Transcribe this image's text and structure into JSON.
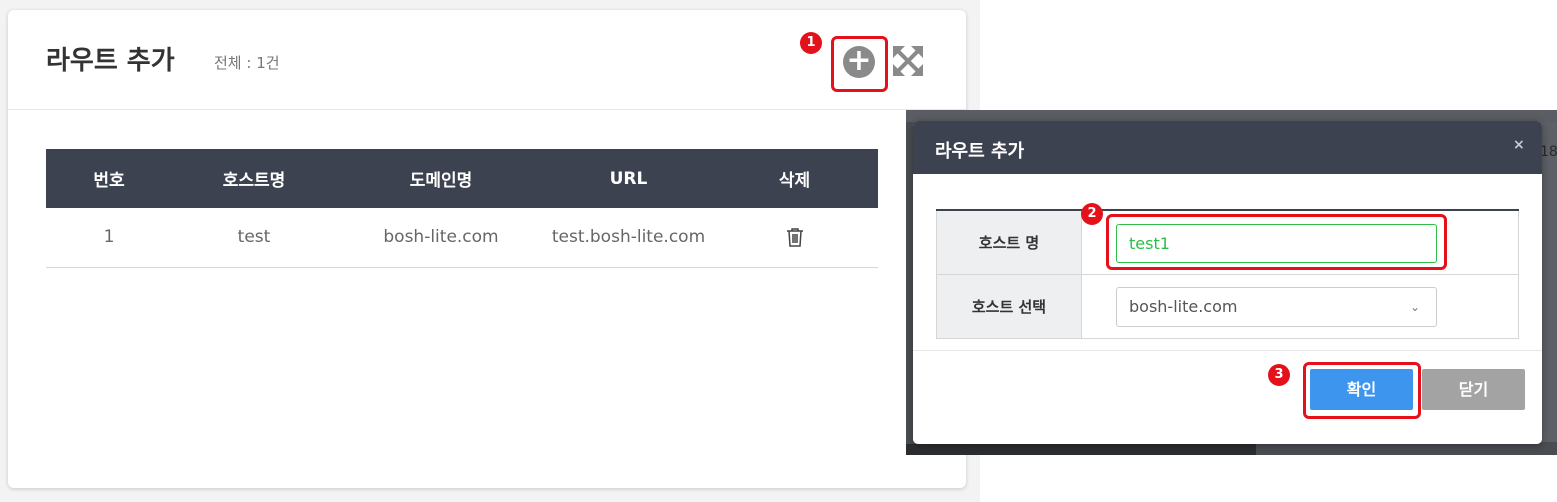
{
  "panel": {
    "title": "라우트 추가",
    "count": "전체 : 1건",
    "add_icon": "plus-circle-icon",
    "expand_icon": "expand-arrows-icon"
  },
  "table": {
    "headers": [
      "번호",
      "호스트명",
      "도메인명",
      "URL",
      "삭제"
    ],
    "rows": [
      {
        "no": "1",
        "host": "test",
        "domain": "bosh-lite.com",
        "url": "test.bosh-lite.com",
        "delete_icon": "trash-icon"
      }
    ]
  },
  "modal": {
    "title": "라우트 추가",
    "close_label": "×",
    "host_label": "호스트 명",
    "host_value": "test1",
    "domain_label": "호스트 선택",
    "domain_value": "bosh-lite.com",
    "confirm_label": "확인",
    "cancel_label": "닫기"
  },
  "background": {
    "edge_text": "18"
  },
  "callouts": [
    "1",
    "2",
    "3"
  ],
  "colors": {
    "header_dark": "#3d4250",
    "callout_red": "#e4111a",
    "confirm_blue": "#3e95ee",
    "input_green": "#2cbe47",
    "close_gray": "#a3a3a3"
  }
}
